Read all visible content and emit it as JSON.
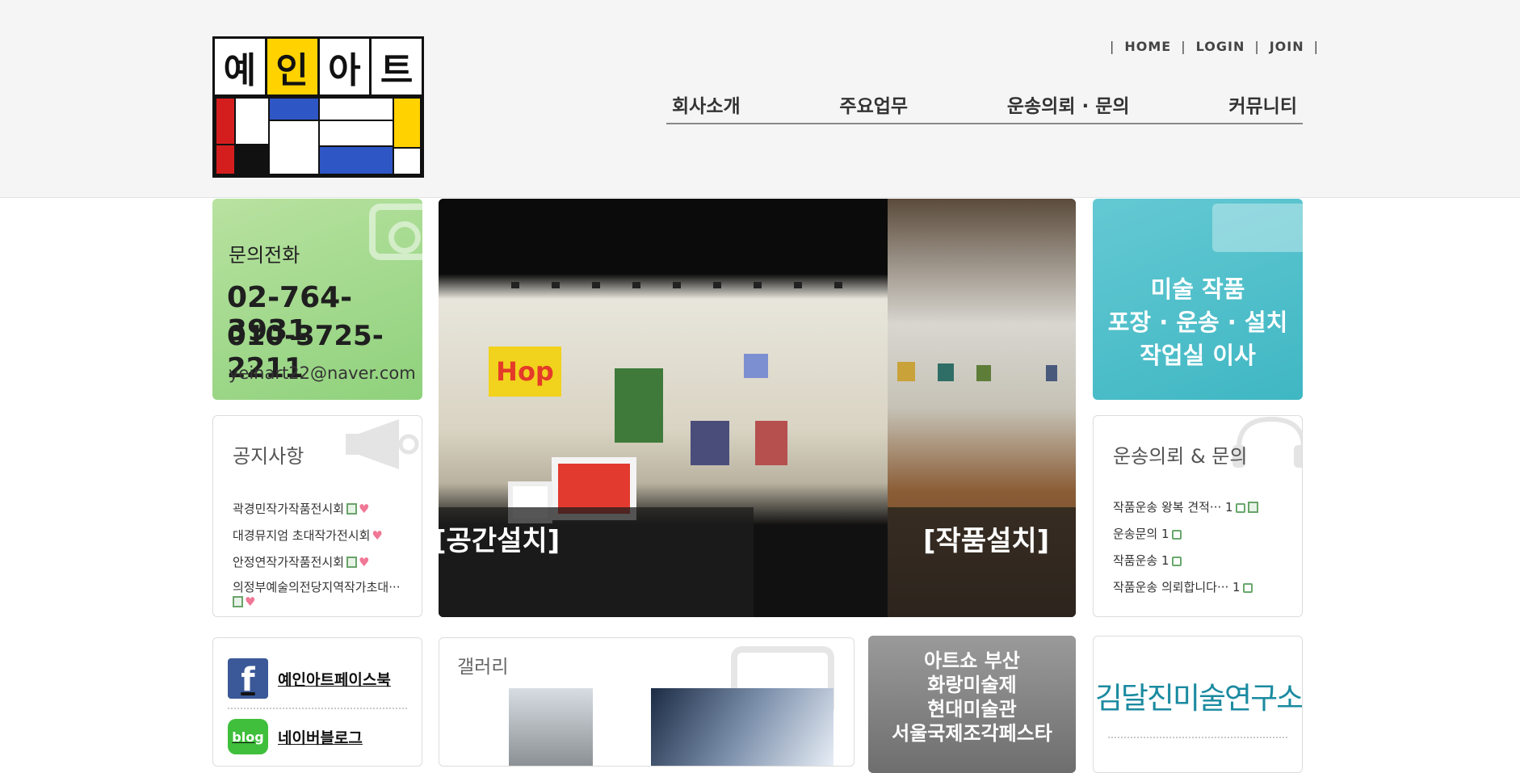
{
  "site": {
    "logo_chars": [
      "예",
      "인",
      "아",
      "트"
    ]
  },
  "util_nav": {
    "items": [
      "HOME",
      "LOGIN",
      "JOIN"
    ]
  },
  "gnb": {
    "items": [
      "회사소개",
      "주요업무",
      "운송의뢰 · 문의",
      "커뮤니티"
    ]
  },
  "contact": {
    "title": "문의전화",
    "phone1": "02-764-3931",
    "phone2": "010-3725-2211",
    "email": "yeinart22@naver.com",
    "colors": {
      "bg": "#9cd88a"
    }
  },
  "hero": {
    "caption_left": "[공간설치]",
    "caption_right": "[작품설치]",
    "art_text": "Hop"
  },
  "services": {
    "lines": [
      "미술 작품",
      "포장 · 운송 · 설치",
      "작업실 이사"
    ],
    "colors": {
      "bg": "#4cc0cc"
    }
  },
  "notice": {
    "title": "공지사항",
    "items": [
      {
        "text": "곽경민작가작품전시회",
        "icons": [
          "doc-icon",
          "heart-icon"
        ]
      },
      {
        "text": "대경뮤지엄 초대작가전시회",
        "icons": [
          "heart-icon"
        ]
      },
      {
        "text": "안정연작가작품전시회",
        "icons": [
          "doc-icon",
          "heart-icon"
        ]
      },
      {
        "text": "의정부예술의전당지역작가초대···",
        "icons": [
          "doc-icon",
          "heart-icon"
        ]
      }
    ]
  },
  "qna": {
    "title": "운송의뢰 & 문의",
    "items": [
      {
        "text": "작품운송 왕복 견적··· 1",
        "icons": [
          "lock-icon",
          "doc-icon"
        ]
      },
      {
        "text": "운송문의 1",
        "icons": [
          "lock-icon"
        ]
      },
      {
        "text": "작품운송 1",
        "icons": [
          "lock-icon"
        ]
      },
      {
        "text": "작품운송 의뢰합니다··· 1",
        "icons": [
          "lock-icon"
        ]
      }
    ]
  },
  "sns": {
    "facebook_label": "예인아트페이스북",
    "blog_label": "네이버블로그",
    "facebook_glyph": "f",
    "blog_glyph": "blog"
  },
  "gallery": {
    "title": "갤러리"
  },
  "artshow": {
    "lines": [
      "아트쇼 부산",
      "화랑미술제",
      "현대미술관",
      "서울국제조각페스타"
    ]
  },
  "institute": {
    "logo_text": "김달진미술연구소"
  }
}
